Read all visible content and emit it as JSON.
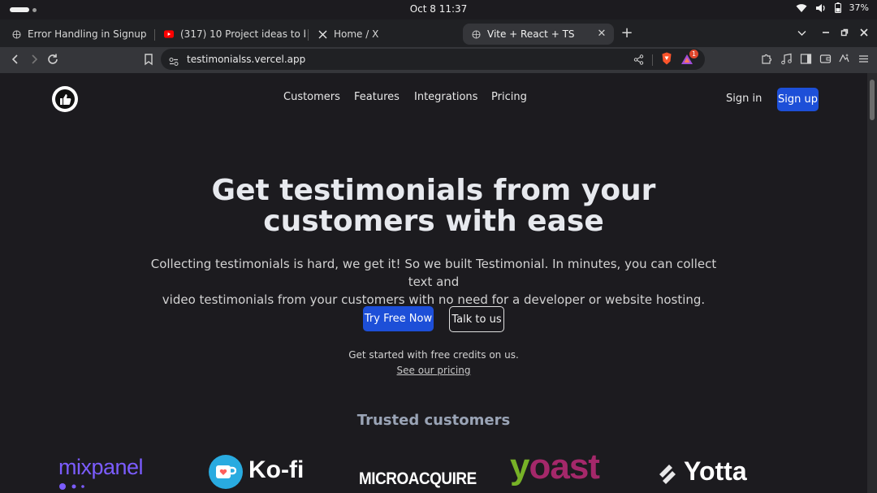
{
  "system": {
    "clock": "Oct 8  11:37",
    "battery": "37%"
  },
  "tabs": [
    {
      "title": "Error Handling in Signup",
      "active": false,
      "favicon": "globe-icon"
    },
    {
      "title": "(317) 10 Project ideas to bui",
      "active": false,
      "favicon": "youtube-icon"
    },
    {
      "title": "Home / X",
      "active": false,
      "favicon": "x-icon"
    },
    {
      "title": "Vite + React + TS",
      "active": true,
      "favicon": "globe-icon"
    }
  ],
  "toolbar": {
    "url": "testimonialss.vercel.app",
    "notification_count": "1"
  },
  "site": {
    "nav": [
      "Customers",
      "Features",
      "Integrations",
      "Pricing"
    ],
    "sign_in": "Sign in",
    "sign_up": "Sign up",
    "hero_title_line1": "Get testimonials from your",
    "hero_title_line2": "customers with ease",
    "hero_sub_line1": "Collecting testimonials is hard, we get it! So we built Testimonial. In minutes, you can collect text and",
    "hero_sub_line2": "video testimonials from your customers with no need for a developer or website hosting.",
    "try_button": "Try Free Now",
    "talk_button": "Talk to us",
    "credits_text": "Get started with free credits on us.",
    "pricing_link": "See our pricing",
    "trusted_heading": "Trusted customers",
    "brands": {
      "mixpanel": "mixpanel",
      "kofi": "Ko-fi",
      "microacquire": "MICROACQUIRE",
      "yoast_y": "y",
      "yoast_rest": "oast",
      "yotta": "Yotta"
    }
  },
  "colors": {
    "accent": "#1d4fd8",
    "background": "#1c1b1f"
  }
}
